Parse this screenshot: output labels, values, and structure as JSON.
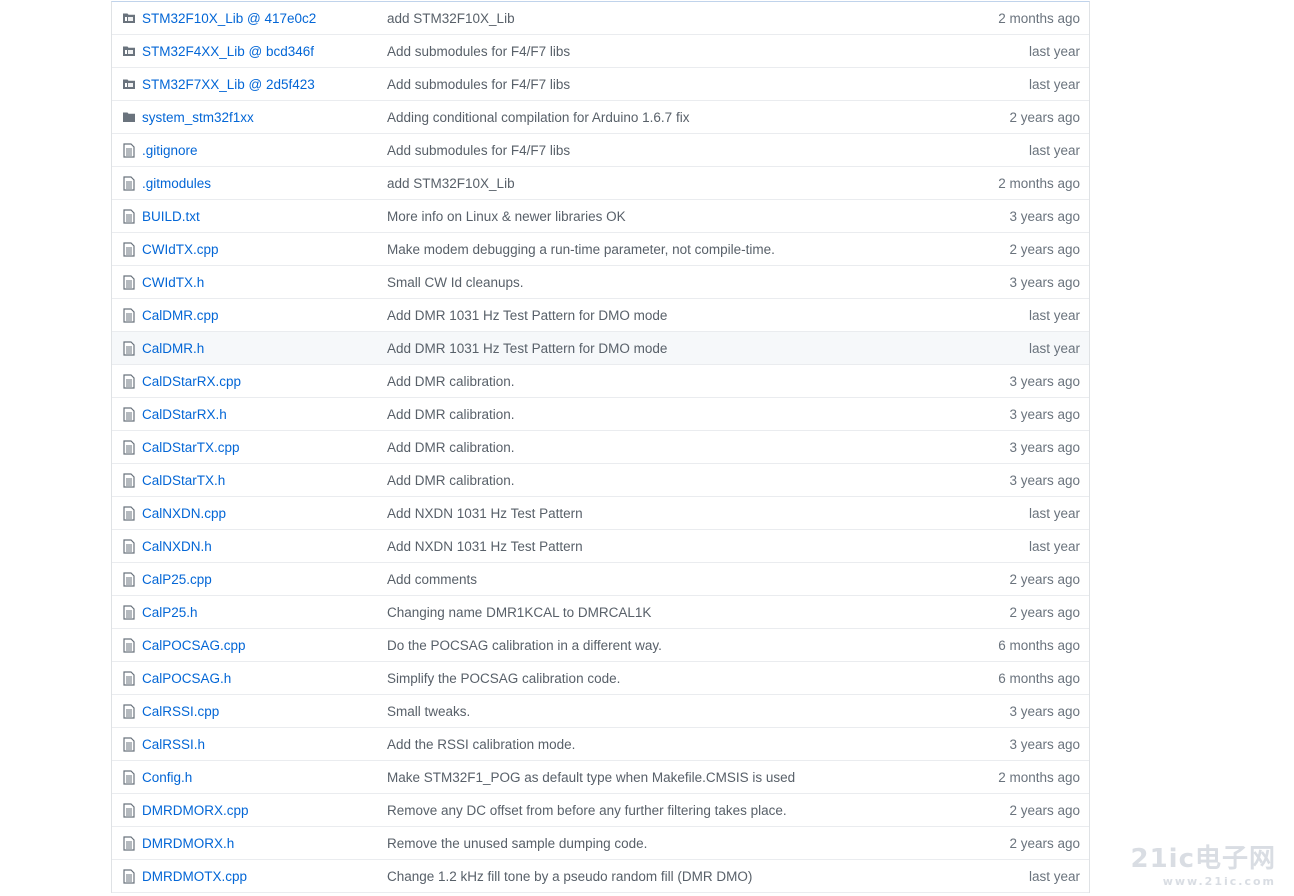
{
  "files": [
    {
      "type": "submodule",
      "name": "STM32F10X_Lib @ 417e0c2",
      "message": "add STM32F10X_Lib",
      "age": "2 months ago"
    },
    {
      "type": "submodule",
      "name": "STM32F4XX_Lib @ bcd346f",
      "message": "Add submodules for F4/F7 libs",
      "age": "last year"
    },
    {
      "type": "submodule",
      "name": "STM32F7XX_Lib @ 2d5f423",
      "message": "Add submodules for F4/F7 libs",
      "age": "last year"
    },
    {
      "type": "folder",
      "name": "system_stm32f1xx",
      "message": "Adding conditional compilation for Arduino 1.6.7 fix",
      "age": "2 years ago"
    },
    {
      "type": "file",
      "name": ".gitignore",
      "message": "Add submodules for F4/F7 libs",
      "age": "last year"
    },
    {
      "type": "file",
      "name": ".gitmodules",
      "message": "add STM32F10X_Lib",
      "age": "2 months ago"
    },
    {
      "type": "file",
      "name": "BUILD.txt",
      "message": "More info on Linux & newer libraries OK",
      "age": "3 years ago"
    },
    {
      "type": "file",
      "name": "CWIdTX.cpp",
      "message": "Make modem debugging a run-time parameter, not compile-time.",
      "age": "2 years ago"
    },
    {
      "type": "file",
      "name": "CWIdTX.h",
      "message": "Small CW Id cleanups.",
      "age": "3 years ago"
    },
    {
      "type": "file",
      "name": "CalDMR.cpp",
      "message": "Add DMR 1031 Hz Test Pattern for DMO mode",
      "age": "last year"
    },
    {
      "type": "file",
      "name": "CalDMR.h",
      "message": "Add DMR 1031 Hz Test Pattern for DMO mode",
      "age": "last year",
      "hover": true
    },
    {
      "type": "file",
      "name": "CalDStarRX.cpp",
      "message": "Add DMR calibration.",
      "age": "3 years ago"
    },
    {
      "type": "file",
      "name": "CalDStarRX.h",
      "message": "Add DMR calibration.",
      "age": "3 years ago"
    },
    {
      "type": "file",
      "name": "CalDStarTX.cpp",
      "message": "Add DMR calibration.",
      "age": "3 years ago"
    },
    {
      "type": "file",
      "name": "CalDStarTX.h",
      "message": "Add DMR calibration.",
      "age": "3 years ago"
    },
    {
      "type": "file",
      "name": "CalNXDN.cpp",
      "message": "Add NXDN 1031 Hz Test Pattern",
      "age": "last year"
    },
    {
      "type": "file",
      "name": "CalNXDN.h",
      "message": "Add NXDN 1031 Hz Test Pattern",
      "age": "last year"
    },
    {
      "type": "file",
      "name": "CalP25.cpp",
      "message": "Add comments",
      "age": "2 years ago"
    },
    {
      "type": "file",
      "name": "CalP25.h",
      "message": "Changing name DMR1KCAL to DMRCAL1K",
      "age": "2 years ago"
    },
    {
      "type": "file",
      "name": "CalPOCSAG.cpp",
      "message": "Do the POCSAG calibration in a different way.",
      "age": "6 months ago"
    },
    {
      "type": "file",
      "name": "CalPOCSAG.h",
      "message": "Simplify the POCSAG calibration code.",
      "age": "6 months ago"
    },
    {
      "type": "file",
      "name": "CalRSSI.cpp",
      "message": "Small tweaks.",
      "age": "3 years ago"
    },
    {
      "type": "file",
      "name": "CalRSSI.h",
      "message": "Add the RSSI calibration mode.",
      "age": "3 years ago"
    },
    {
      "type": "file",
      "name": "Config.h",
      "message": "Make STM32F1_POG as default type when Makefile.CMSIS is used",
      "age": "2 months ago"
    },
    {
      "type": "file",
      "name": "DMRDMORX.cpp",
      "message": "Remove any DC offset from before any further filtering takes place.",
      "age": "2 years ago"
    },
    {
      "type": "file",
      "name": "DMRDMORX.h",
      "message": "Remove the unused sample dumping code.",
      "age": "2 years ago"
    },
    {
      "type": "file",
      "name": "DMRDMOTX.cpp",
      "message": "Change 1.2 kHz fill tone by a pseudo random fill (DMR DMO)",
      "age": "last year"
    }
  ],
  "watermark": {
    "main": "21ic电子网",
    "sub": "www.21ic.com"
  },
  "colors": {
    "link": "#0366d6",
    "icon": "#6a737d",
    "folder": "#79b8ff"
  }
}
